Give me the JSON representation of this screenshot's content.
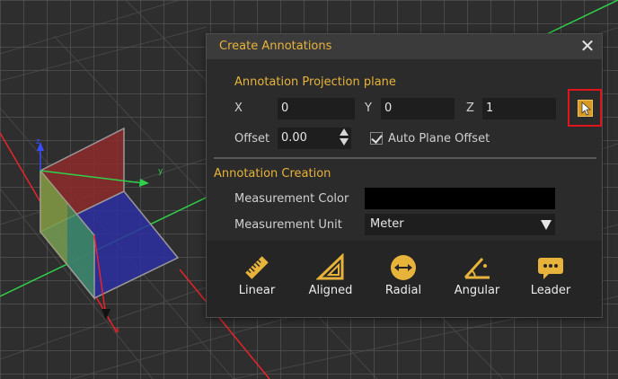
{
  "viewport": {
    "axis_labels": {
      "x": "x",
      "y": "y",
      "z": "z"
    },
    "colors": {
      "x_axis": "#e8242a",
      "y_axis": "#2fd04a",
      "z_axis": "#3a4cff"
    }
  },
  "dialog": {
    "title": "Create Annotations",
    "close_label": "✕",
    "projection": {
      "section_title": "Annotation Projection plane",
      "x_label": "X",
      "x_value": "0",
      "y_label": "Y",
      "y_value": "0",
      "z_label": "Z",
      "z_value": "1",
      "offset_label": "Offset",
      "offset_value": "0.00",
      "auto_offset_label": "Auto Plane Offset",
      "auto_offset_checked": true,
      "pick_icon": "pick-plane-icon"
    },
    "creation": {
      "section_title": "Annotation Creation",
      "color_label": "Measurement Color",
      "color_value": "#000000",
      "unit_label": "Measurement Unit",
      "unit_value": "Meter"
    },
    "tools": [
      {
        "label": "Linear",
        "icon": "ruler-icon"
      },
      {
        "label": "Aligned",
        "icon": "set-square-icon"
      },
      {
        "label": "Radial",
        "icon": "radius-icon"
      },
      {
        "label": "Angular",
        "icon": "angle-icon"
      },
      {
        "label": "Leader",
        "icon": "speech-bubble-icon"
      }
    ],
    "accent_color": "#e8b33a"
  }
}
